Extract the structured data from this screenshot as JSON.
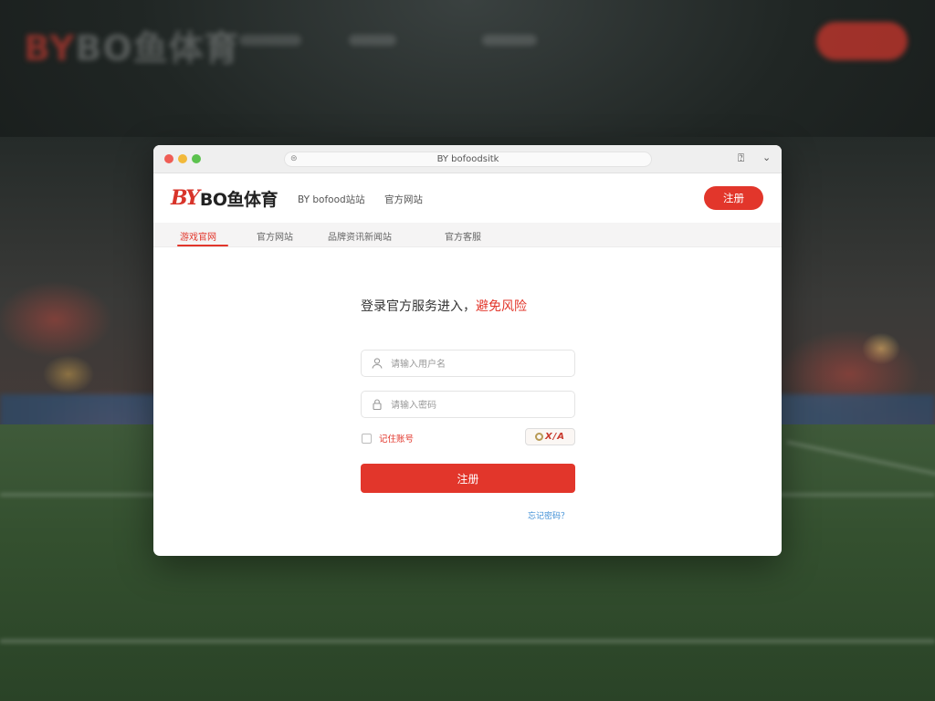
{
  "background": {
    "logo_mark": "BY",
    "logo_text": "BO鱼体育"
  },
  "browser": {
    "address_bar": "BY bofoodsitk"
  },
  "site": {
    "logo_mark": "BY",
    "logo_text": "BO鱼体育",
    "header_links": [
      "BY bofood站站",
      "官方网站"
    ],
    "register_button": "注册"
  },
  "tabs": {
    "items": [
      "游戏官网",
      "官方网站",
      "品牌资讯新闻站",
      "官方客服"
    ],
    "active_index": 0
  },
  "form": {
    "headline_prefix": "登录官方服务进入，",
    "headline_highlight": "避免风险",
    "username_placeholder": "请输入用户名",
    "password_placeholder": "请输入密码",
    "remember_label": "记住账号",
    "captcha_text": "X/A",
    "submit_label": "注册",
    "forgot_link": "忘记密码？"
  },
  "colors": {
    "accent": "#e2362b",
    "link": "#3f8fd6"
  }
}
